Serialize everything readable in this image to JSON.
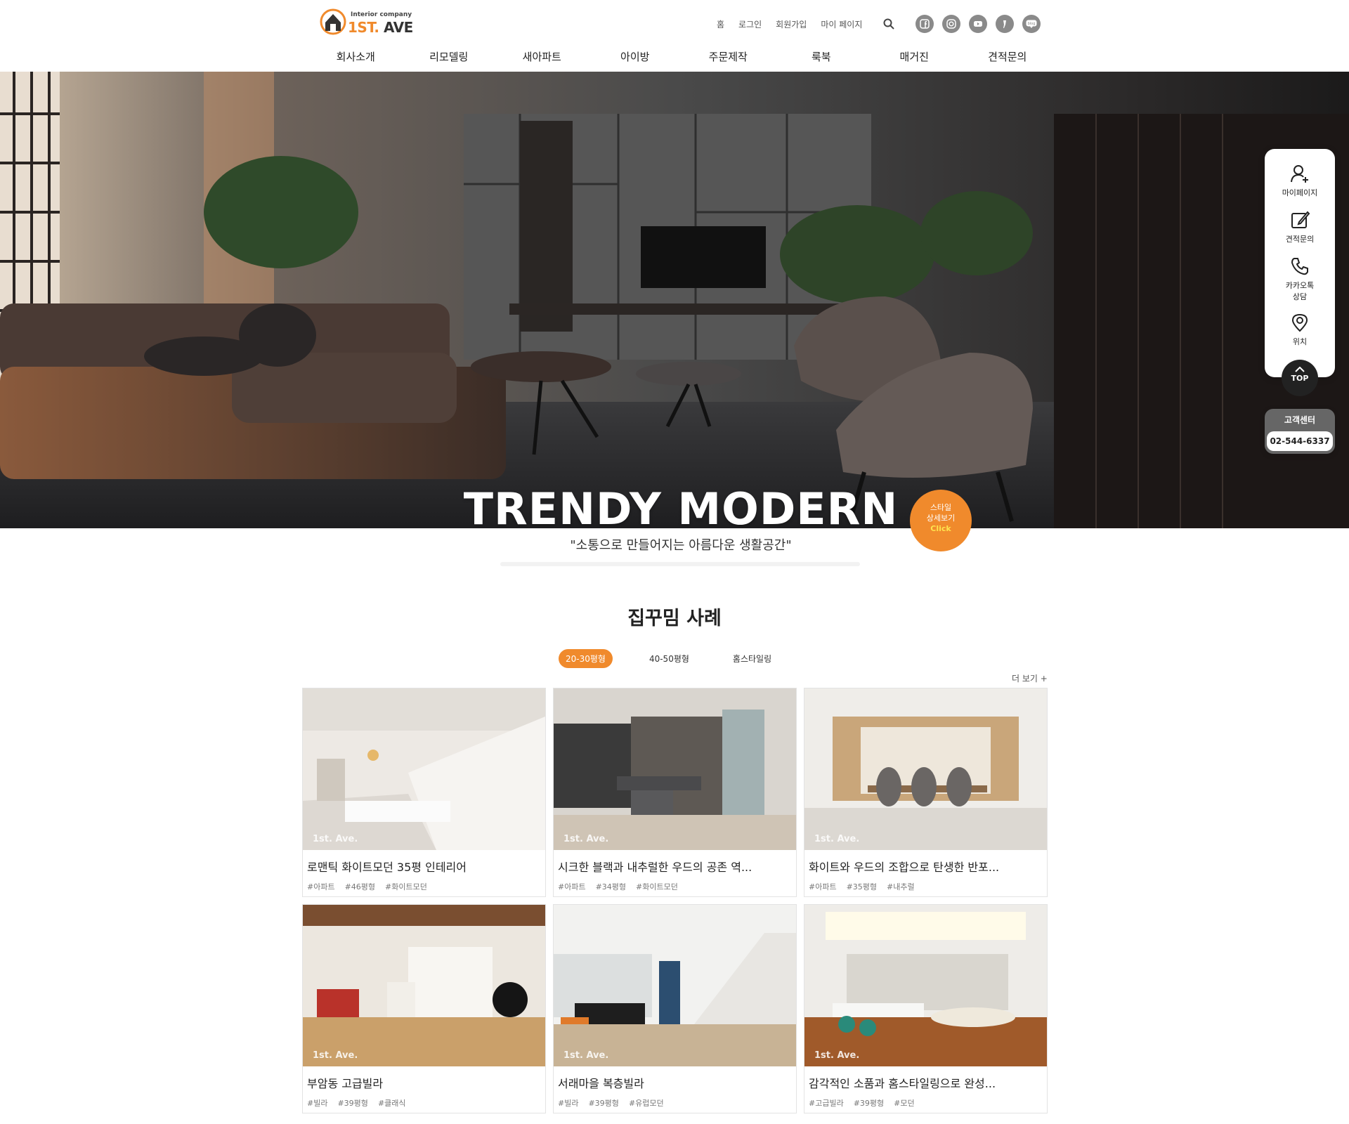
{
  "header": {
    "logo": {
      "small": "Interior company",
      "main_a": "1ST.",
      "main_b": " AVE"
    },
    "util_links": [
      "홈",
      "로그인",
      "회원가입",
      "마이 페이지"
    ],
    "sns": [
      "facebook-icon",
      "instagram-icon",
      "youtube-icon",
      "kakao-story-icon",
      "blog-icon"
    ],
    "nav": [
      "회사소개",
      "리모델링",
      "새아파트",
      "아이방",
      "주문제작",
      "룩북",
      "매거진",
      "견적문의"
    ]
  },
  "hero": {
    "title": "TRENDY MODERN",
    "subtitle": "\"소통으로 만들어지는 아름다운 생활공간\"",
    "style_button": {
      "line1": "스타일",
      "line2": "상세보기",
      "click": "Click"
    }
  },
  "quick_menu": {
    "items": [
      "마이페이지",
      "견적문의",
      "카카오톡 상담",
      "위치"
    ],
    "top": "TOP",
    "cs_title": "고객센터",
    "cs_phone": "02-544-6337"
  },
  "section": {
    "title": "집꾸밈 사례",
    "tabs": [
      "20-30평형",
      "40-50평형",
      "홈스타일링"
    ],
    "active_tab": "20-30평형",
    "more": "더 보기 +",
    "cards": [
      {
        "title": "로맨틱 화이트모던 35평 인테리어",
        "tags": [
          "#아파트",
          "#46평형",
          "#화이트모던"
        ]
      },
      {
        "title": "시크한 블랙과 내추럴한 우드의 공존 역...",
        "tags": [
          "#아파트",
          "#34평형",
          "#화이트모던"
        ]
      },
      {
        "title": "화이트와 우드의 조합으로 탄생한 반포...",
        "tags": [
          "#아파트",
          "#35평형",
          "#내추럴"
        ]
      },
      {
        "title": "부암동 고급빌라",
        "tags": [
          "#빌라",
          "#39평형",
          "#클래식"
        ]
      },
      {
        "title": "서래마을 복층빌라",
        "tags": [
          "#빌라",
          "#39평형",
          "#유럽모던"
        ]
      },
      {
        "title": "감각적인 소품과 홈스타일링으로 완성...",
        "tags": [
          "#고급빌라",
          "#39평형",
          "#모던"
        ]
      }
    ],
    "watermark": "1st. Ave."
  }
}
